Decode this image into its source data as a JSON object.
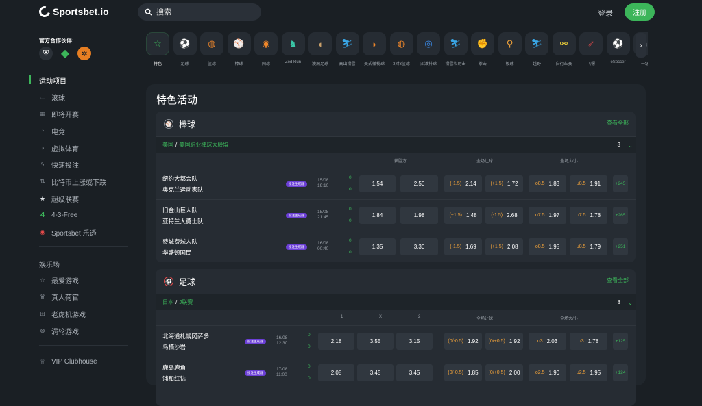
{
  "brand": {
    "name": "Sportsbet.io"
  },
  "search": {
    "placeholder": "搜索"
  },
  "header": {
    "login": "登录",
    "register": "注册"
  },
  "sidebar": {
    "partners_label": "官方合作伙伴:",
    "sports_title": "运动项目",
    "items": [
      {
        "label": "滚球",
        "icon": "tv-icon"
      },
      {
        "label": "即将开赛",
        "icon": "calendar-icon"
      },
      {
        "label": "电竞",
        "icon": "gamepad-icon"
      },
      {
        "label": "虚拟体育",
        "icon": "virtual-icon"
      },
      {
        "label": "快速投注",
        "icon": "flash-icon"
      },
      {
        "label": "比特币上涨或下跌",
        "icon": "updown-icon"
      },
      {
        "label": "超级联赛",
        "icon": "star-icon"
      },
      {
        "label": "4-3-Free",
        "icon": "four-icon"
      },
      {
        "label": "Sportsbet 乐透",
        "icon": "lottery-icon"
      }
    ],
    "casino_title": "娱乐场",
    "casino_items": [
      {
        "label": "最爱游戏",
        "icon": "star-outline-icon"
      },
      {
        "label": "真人荷官",
        "icon": "dealer-icon"
      },
      {
        "label": "老虎机游戏",
        "icon": "slot-icon"
      },
      {
        "label": "涡轮游戏",
        "icon": "turbo-icon"
      }
    ],
    "vip": "VIP Clubhouse"
  },
  "categories": [
    {
      "label": "特色",
      "icon": "☆",
      "color": "#3cb55a"
    },
    {
      "label": "足球",
      "icon": "⚽",
      "color": "#e84a4a"
    },
    {
      "label": "篮球",
      "icon": "◍",
      "color": "#f0872a"
    },
    {
      "label": "棒球",
      "icon": "⚾",
      "color": "#c9a06a"
    },
    {
      "label": "网球",
      "icon": "◉",
      "color": "#f0872a"
    },
    {
      "label": "Zed Run",
      "icon": "♞",
      "color": "#3ac8a8"
    },
    {
      "label": "澳洲足球",
      "icon": "◖",
      "color": "#c9a06a"
    },
    {
      "label": "高山滑雪",
      "icon": "⛷",
      "color": "#3aa8e8"
    },
    {
      "label": "美式橄榄球",
      "icon": "◗",
      "color": "#f0872a"
    },
    {
      "label": "3对3篮球",
      "icon": "◍",
      "color": "#f0872a"
    },
    {
      "label": "沙滩排球",
      "icon": "◎",
      "color": "#3a8ae8"
    },
    {
      "label": "滑雪和射击",
      "icon": "⛷",
      "color": "#3aa8e8"
    },
    {
      "label": "拳击",
      "icon": "✊",
      "color": "#e84a4a"
    },
    {
      "label": "板球",
      "icon": "⚲",
      "color": "#f0a23a"
    },
    {
      "label": "越野",
      "icon": "⛷",
      "color": "#3aa8e8"
    },
    {
      "label": "自行车赛",
      "icon": "⚯",
      "color": "#f0d23a"
    },
    {
      "label": "飞镖",
      "icon": "➶",
      "color": "#e84a4a"
    },
    {
      "label": "eSoccer",
      "icon": "⚽",
      "color": "#e84a4a"
    },
    {
      "label": "一级",
      "icon": "◌",
      "color": "#8a9097"
    }
  ],
  "main": {
    "title": "特色活动"
  },
  "baseball": {
    "sport": "棒球",
    "view_all": "查看全部",
    "league_country": "美国",
    "league_name": "美国职业棒球大联盟",
    "count": "3",
    "cols": {
      "winner": "获胜方",
      "handicap": "全场让球",
      "total": "全场大/小"
    },
    "badge": "投注生成器",
    "rows": [
      {
        "home": "纽约大都会队",
        "away": "奥克兰运动家队",
        "date": "15/08",
        "time": "19:10",
        "s1": "0",
        "s2": "0",
        "o1": "1.54",
        "o2": "2.50",
        "h1": "(-1.5)",
        "ho1": "2.14",
        "h2": "(+1.5)",
        "ho2": "1.72",
        "t1": "o8.5",
        "to1": "1.83",
        "t2": "u8.5",
        "to2": "1.91",
        "more": "+245"
      },
      {
        "home": "旧金山巨人队",
        "away": "亚特兰大勇士队",
        "date": "15/08",
        "time": "21:45",
        "s1": "0",
        "s2": "0",
        "o1": "1.84",
        "o2": "1.98",
        "h1": "(+1.5)",
        "ho1": "1.48",
        "h2": "(-1.5)",
        "ho2": "2.68",
        "t1": "o7.5",
        "to1": "1.97",
        "t2": "u7.5",
        "to2": "1.78",
        "more": "+265"
      },
      {
        "home": "费城费城人队",
        "away": "华盛顿国民",
        "date": "16/08",
        "time": "00:40",
        "s1": "0",
        "s2": "0",
        "o1": "1.35",
        "o2": "3.30",
        "h1": "(-1.5)",
        "ho1": "1.69",
        "h2": "(+1.5)",
        "ho2": "2.08",
        "t1": "o8.5",
        "to1": "1.95",
        "t2": "u8.5",
        "to2": "1.79",
        "more": "+251"
      }
    ]
  },
  "soccer": {
    "sport": "足球",
    "view_all": "查看全部",
    "league_country": "日本",
    "league_name": "J联赛",
    "count": "8",
    "cols": {
      "one": "1",
      "x": "X",
      "two": "2",
      "handicap": "全场让球",
      "total": "全场大/小"
    },
    "badge": "投注生成器",
    "rows": [
      {
        "home": "北海道札幌冈萨多",
        "away": "鸟栖沙岩",
        "date": "16/08",
        "time": "12:30",
        "s1": "0",
        "s2": "0",
        "o1": "2.18",
        "ox": "3.55",
        "o2": "3.15",
        "h1": "(0/-0.5)",
        "ho1": "1.92",
        "h2": "(0/+0.5)",
        "ho2": "1.92",
        "t1": "o3",
        "to1": "2.03",
        "t2": "u3",
        "to2": "1.78",
        "more": "+125"
      },
      {
        "home": "鹿岛鹿角",
        "away": "浦和红钻",
        "date": "17/08",
        "time": "11:00",
        "s1": "0",
        "s2": "0",
        "o1": "2.08",
        "ox": "3.45",
        "o2": "3.45",
        "h1": "(0/-0.5)",
        "ho1": "1.85",
        "h2": "(0/+0.5)",
        "ho2": "2.00",
        "t1": "o2.5",
        "to1": "1.90",
        "t2": "u2.5",
        "to2": "1.95",
        "more": "+124"
      }
    ]
  }
}
